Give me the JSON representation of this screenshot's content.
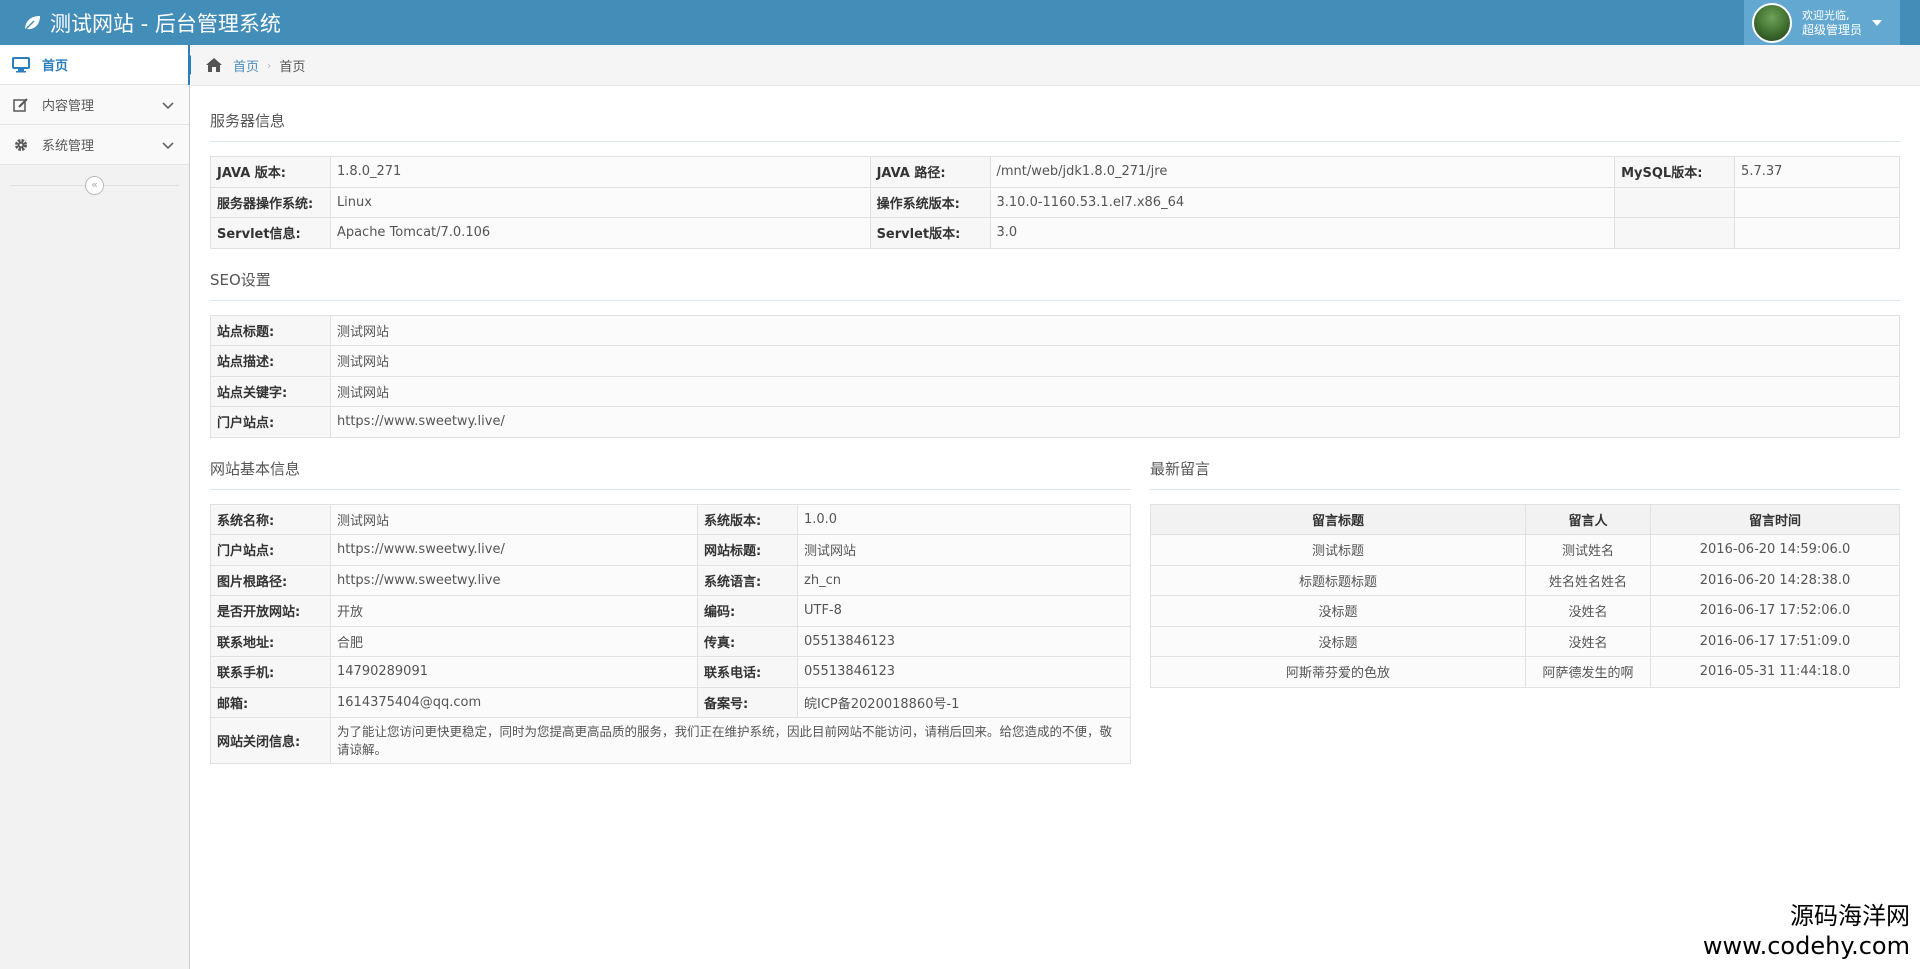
{
  "app": {
    "title": "测试网站 - 后台管理系统",
    "welcome": "欢迎光临,",
    "role": "超级管理员"
  },
  "sidebar": {
    "items": [
      {
        "label": "首页",
        "icon": "desktop-icon",
        "active": true
      },
      {
        "label": "内容管理",
        "icon": "edit-icon",
        "active": false
      },
      {
        "label": "系统管理",
        "icon": "gear-icon",
        "active": false
      }
    ],
    "collapse_glyph": "«"
  },
  "breadcrumb": {
    "home_link": "首页",
    "current": "首页"
  },
  "server": {
    "title": "服务器信息",
    "rows": [
      [
        "JAVA 版本:",
        "1.8.0_271",
        "JAVA 路径:",
        "/mnt/web/jdk1.8.0_271/jre",
        "MySQL版本:",
        "5.7.37"
      ],
      [
        "服务器操作系统:",
        "Linux",
        "操作系统版本:",
        "3.10.0-1160.53.1.el7.x86_64",
        "",
        ""
      ],
      [
        "Servlet信息:",
        "Apache Tomcat/7.0.106",
        "Servlet版本:",
        "3.0",
        "",
        ""
      ]
    ]
  },
  "seo": {
    "title": "SEO设置",
    "rows": [
      [
        "站点标题:",
        "测试网站"
      ],
      [
        "站点描述:",
        "测试网站"
      ],
      [
        "站点关键字:",
        "测试网站"
      ],
      [
        "门户站点:",
        "https://www.sweetwy.live/"
      ]
    ]
  },
  "site": {
    "title": "网站基本信息",
    "rows": [
      [
        "系统名称:",
        "测试网站",
        "系统版本:",
        "1.0.0"
      ],
      [
        "门户站点:",
        "https://www.sweetwy.live/",
        "网站标题:",
        "测试网站"
      ],
      [
        "图片根路径:",
        "https://www.sweetwy.live",
        "系统语言:",
        "zh_cn"
      ],
      [
        "是否开放网站:",
        "开放",
        "编码:",
        "UTF-8"
      ],
      [
        "联系地址:",
        "合肥",
        "传真:",
        "05513846123"
      ],
      [
        "联系手机:",
        "14790289091",
        "联系电话:",
        "05513846123"
      ],
      [
        "邮箱:",
        "1614375404@qq.com",
        "备案号:",
        "皖ICP备2020018860号-1"
      ]
    ],
    "closed_label": "网站关闭信息:",
    "closed_text": "为了能让您访问更快更稳定，同时为您提高更高品质的服务，我们正在维护系统，因此目前网站不能访问，请稍后回来。给您造成的不便，敬请谅解。"
  },
  "messages": {
    "title": "最新留言",
    "headers": [
      "留言标题",
      "留言人",
      "留言时间"
    ],
    "rows": [
      [
        "测试标题",
        "测试姓名",
        "2016-06-20 14:59:06.0"
      ],
      [
        "标题标题标题",
        "姓名姓名姓名",
        "2016-06-20 14:28:38.0"
      ],
      [
        "没标题",
        "没姓名",
        "2016-06-17 17:52:06.0"
      ],
      [
        "没标题",
        "没姓名",
        "2016-06-17 17:51:09.0"
      ],
      [
        "阿斯蒂芬爱的色放",
        "阿萨德发生的啊",
        "2016-05-31 11:44:18.0"
      ]
    ]
  },
  "watermark": {
    "cn": "源码海洋网",
    "url": "www.codehy.com"
  },
  "colors": {
    "navbar": "#438eb9",
    "userbox": "#62a8d1",
    "accent": "#2b7dbc"
  }
}
